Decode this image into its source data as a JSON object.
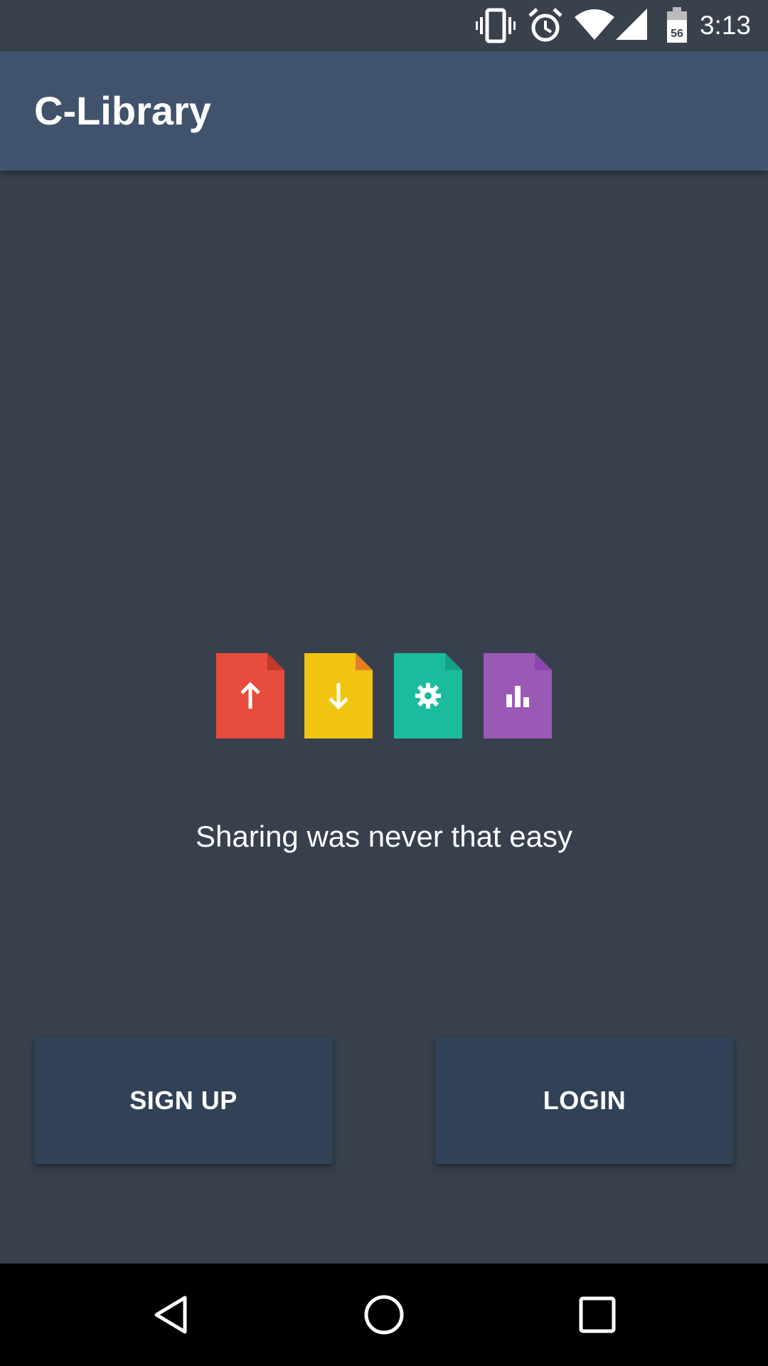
{
  "status_bar": {
    "time": "3:13",
    "battery_level": "56",
    "icons": [
      "vibrate-icon",
      "alarm-icon",
      "wifi-icon",
      "cell-signal-icon",
      "battery-icon"
    ]
  },
  "app_bar": {
    "title": "C-Library"
  },
  "hero": {
    "documents": [
      {
        "icon": "upload-document-icon",
        "color": "#e74c3c"
      },
      {
        "icon": "download-document-icon",
        "color": "#f1c40f"
      },
      {
        "icon": "settings-document-icon",
        "color": "#1abc9c"
      },
      {
        "icon": "chart-document-icon",
        "color": "#9b59b6"
      }
    ],
    "tagline": "Sharing was never that easy"
  },
  "actions": {
    "signup_label": "SIGN UP",
    "login_label": "LOGIN"
  },
  "nav_bar": {
    "buttons": [
      "back-icon",
      "home-icon",
      "recents-icon"
    ]
  },
  "colors": {
    "background": "#38404d",
    "app_bar": "#41536c",
    "button": "#314157"
  }
}
